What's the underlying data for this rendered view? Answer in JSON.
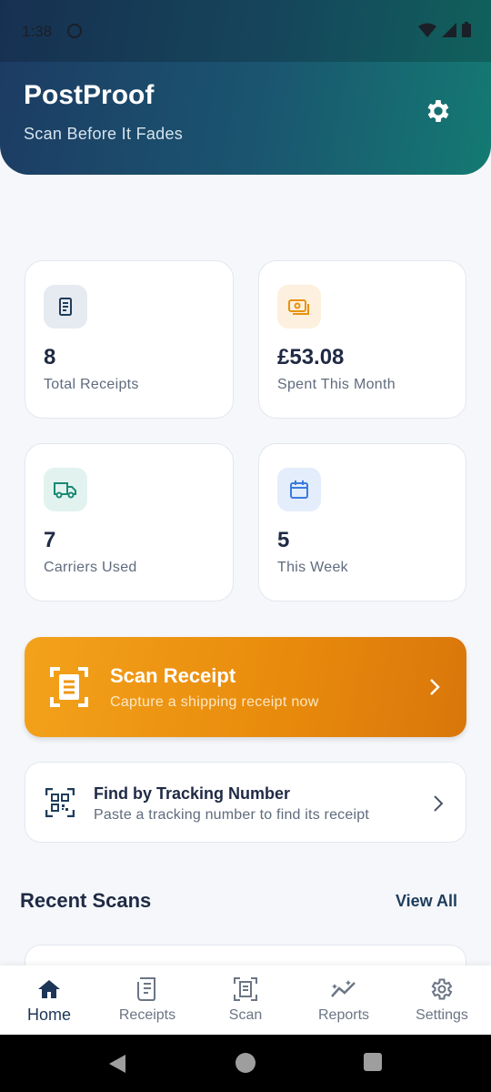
{
  "status_bar": {
    "time": "1:38"
  },
  "header": {
    "title": "PostProof",
    "subtitle": "Scan Before It Fades"
  },
  "stats": [
    {
      "value": "8",
      "label": "Total Receipts",
      "icon": "receipt-icon",
      "tile_color": "#e6eaf1",
      "icon_color": "#1f3d5c"
    },
    {
      "value": "£53.08",
      "label": "Spent This Month",
      "icon": "money-icon",
      "tile_color": "#fdf0de",
      "icon_color": "#e8920f"
    },
    {
      "value": "7",
      "label": "Carriers Used",
      "icon": "truck-icon",
      "tile_color": "#e2f3ef",
      "icon_color": "#1a8a74"
    },
    {
      "value": "5",
      "label": "This Week",
      "icon": "calendar-icon",
      "tile_color": "#e4edfb",
      "icon_color": "#3b7be0"
    }
  ],
  "scan_cta": {
    "title": "Scan Receipt",
    "subtitle": "Capture a shipping receipt now"
  },
  "tracking": {
    "title": "Find by Tracking Number",
    "subtitle": "Paste a tracking number to find its receipt"
  },
  "recent": {
    "title": "Recent Scans",
    "view_all": "View All"
  },
  "nav": [
    {
      "label": "Home",
      "icon": "home-icon",
      "active": true
    },
    {
      "label": "Receipts",
      "icon": "receipt-icon",
      "active": false
    },
    {
      "label": "Scan",
      "icon": "scan-icon",
      "active": false
    },
    {
      "label": "Reports",
      "icon": "chart-icon",
      "active": false
    },
    {
      "label": "Settings",
      "icon": "gear-icon",
      "active": false
    }
  ],
  "colors": {
    "primary": "#1d3557",
    "accent": "#f39c12",
    "header_gradient_start": "#1d3b63",
    "header_gradient_end": "#147a72"
  }
}
